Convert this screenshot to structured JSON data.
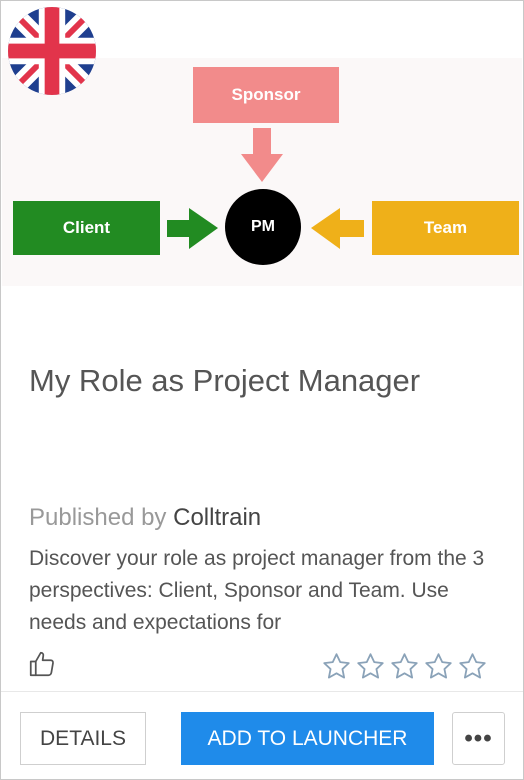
{
  "diagram": {
    "sponsor": "Sponsor",
    "client": "Client",
    "team": "Team",
    "pm": "PM",
    "colors": {
      "sponsor": "#f28b8b",
      "client": "#228b22",
      "team": "#efb019",
      "pm": "#000000"
    }
  },
  "flag_icon": "uk-flag-icon",
  "card": {
    "title": "My Role as Project Manager",
    "published_prefix": "Published by",
    "publisher": "Colltrain",
    "description": "Discover your role as project manager from the 3 perspectives: Client, Sponsor and Team. Use needs and expectations for",
    "rating_stars_total": 5,
    "rating_stars_filled": 0
  },
  "actions": {
    "details": "DETAILS",
    "add_to_launcher": "ADD TO LAUNCHER",
    "more": "•••"
  }
}
